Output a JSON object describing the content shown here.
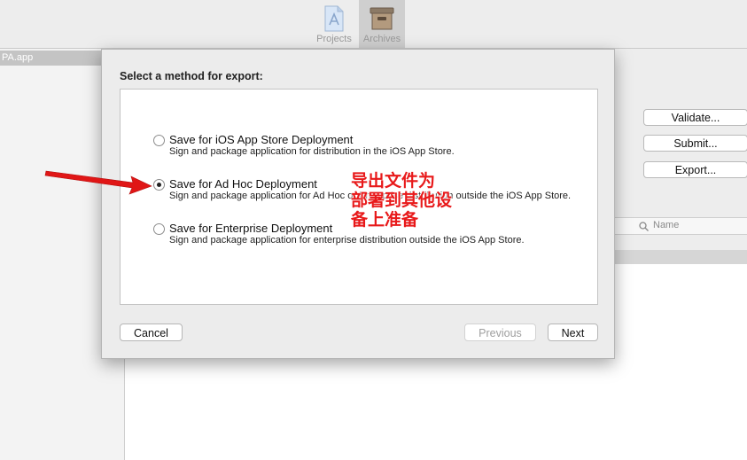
{
  "toolbar": {
    "projects_label": "Projects",
    "archives_label": "Archives"
  },
  "sidebar": {
    "selected_item": "PA.app"
  },
  "right_panel": {
    "validate_label": "Validate...",
    "submit_label": "Submit...",
    "export_label": "Export...",
    "search_column": "Name"
  },
  "sheet": {
    "title": "Select a method for export:",
    "options": [
      {
        "title": "Save for iOS App Store Deployment",
        "description": "Sign and package application for distribution in the iOS App Store.",
        "selected": false
      },
      {
        "title": "Save for Ad Hoc Deployment",
        "description": "Sign and package application for Ad Hoc or Enterprise distribution outside the iOS App Store.",
        "selected": true
      },
      {
        "title": "Save for Enterprise Deployment",
        "description": "Sign and package application for enterprise distribution outside the iOS App Store.",
        "selected": false
      }
    ],
    "cancel_label": "Cancel",
    "previous_label": "Previous",
    "next_label": "Next"
  },
  "annotation": {
    "line1": "导出文件为",
    "line2": "部署到其他设",
    "line3": "备上准备",
    "color": "#e8191a"
  }
}
